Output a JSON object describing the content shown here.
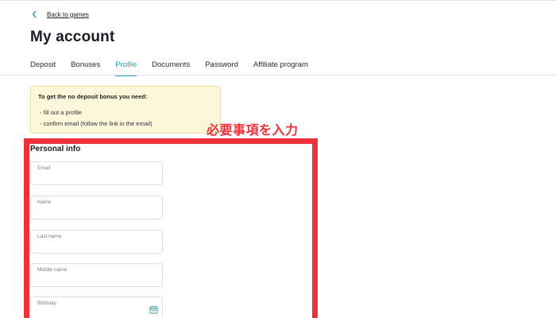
{
  "nav": {
    "back_label": "Back to games"
  },
  "page_title": "My account",
  "tabs": [
    {
      "label": "Deposit",
      "active": false
    },
    {
      "label": "Bonuses",
      "active": false
    },
    {
      "label": "Profile",
      "active": true
    },
    {
      "label": "Documents",
      "active": false
    },
    {
      "label": "Password",
      "active": false
    },
    {
      "label": "Affiliate program",
      "active": false
    }
  ],
  "notice": {
    "title": "To get the no deposit bonus you need:",
    "items": [
      "- fill out a profile",
      "- confirm email (follow the link in the email)"
    ]
  },
  "annotation": {
    "text": "必要事項を入力",
    "color": "#ee3138"
  },
  "personal_info": {
    "title": "Personal info",
    "fields": [
      {
        "label": "Email",
        "value": ""
      },
      {
        "label": "Name",
        "value": ""
      },
      {
        "label": "Last name",
        "value": ""
      },
      {
        "label": "Middle name",
        "value": ""
      },
      {
        "label": "Birthday",
        "value": "",
        "icon": "calendar-icon"
      }
    ]
  },
  "colors": {
    "accent": "#2b9fb2",
    "notice_bg": "#fcf7da",
    "highlight": "#ee3138"
  }
}
